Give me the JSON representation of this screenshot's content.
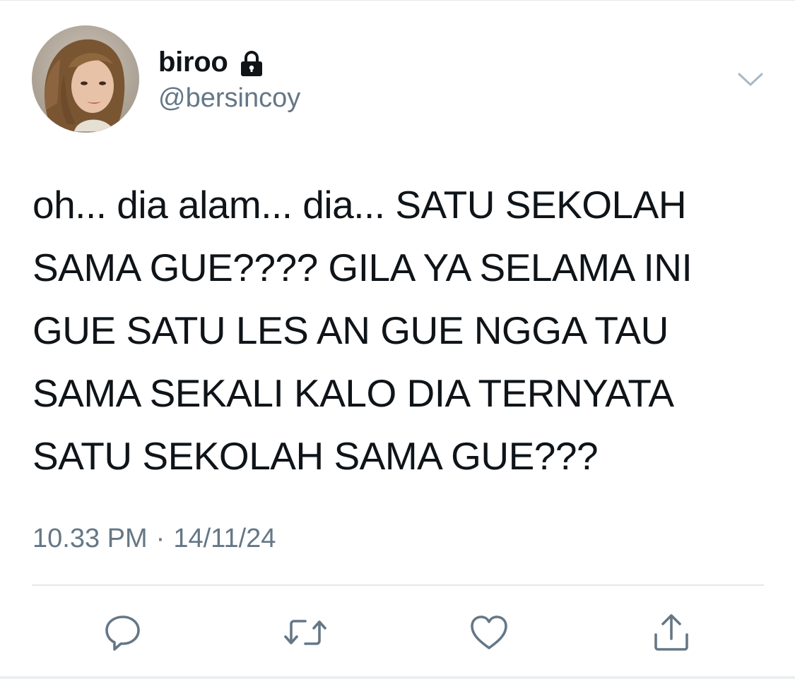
{
  "author": {
    "display_name": "biroo",
    "handle": "@bersincoy",
    "protected_icon": "lock-icon",
    "avatar_icon": "avatar"
  },
  "tweet": {
    "text_lines": [
      "oh... dia alam... dia... SATU SEKOLAH",
      "SAMA GUE???? GILA YA SELAMA INI",
      "GUE SATU LES AN GUE NGGA TAU",
      "SAMA SEKALI KALO DIA TERNYATA",
      "SATU SEKOLAH SAMA GUE???"
    ],
    "time": "10.33 PM",
    "separator": "·",
    "date": "14/11/24"
  },
  "actions": {
    "reply_icon": "reply-icon",
    "retweet_icon": "retweet-icon",
    "like_icon": "heart-icon",
    "share_icon": "share-icon",
    "menu_icon": "chevron-down-icon"
  },
  "colors": {
    "text": "#0f1419",
    "secondary": "#657786",
    "divider": "#e1e8ed",
    "icon": "#657786"
  }
}
